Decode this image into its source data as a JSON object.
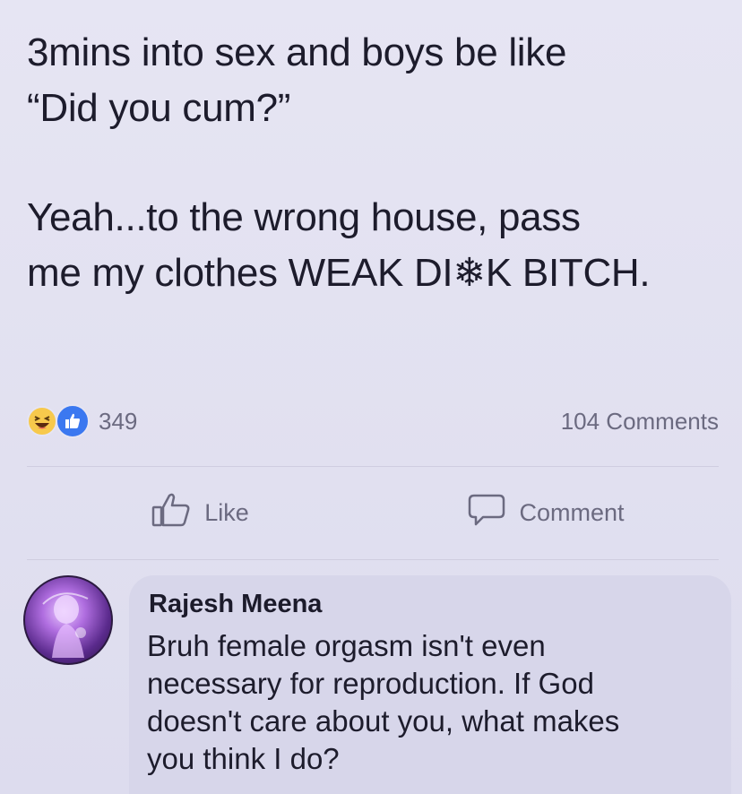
{
  "post": {
    "text_line1": "3mins into sex and boys be like",
    "text_line2": "“Did you cum?”",
    "text_line3": "Yeah...to the wrong house, pass",
    "text_line4": "me my clothes WEAK DI❄K BITCH."
  },
  "stats": {
    "reaction_count": "349",
    "reactions": [
      "haha-icon",
      "like-icon"
    ],
    "comments_count": "104 Comments"
  },
  "actions": {
    "like_label": "Like",
    "comment_label": "Comment"
  },
  "comment": {
    "author": "Rajesh Meena",
    "line1": "Bruh female orgasm isn't even",
    "line2": "necessary for reproduction. If God",
    "line3": "doesn't care about you, what makes",
    "line4": "you think I do?"
  },
  "colors": {
    "background": "#e4e3f2",
    "text": "#1d1c2c",
    "muted": "#6b6a80",
    "like_blue": "#3b78f0",
    "haha_yellow": "#f7c94c",
    "bubble": "#d7d6ea"
  }
}
